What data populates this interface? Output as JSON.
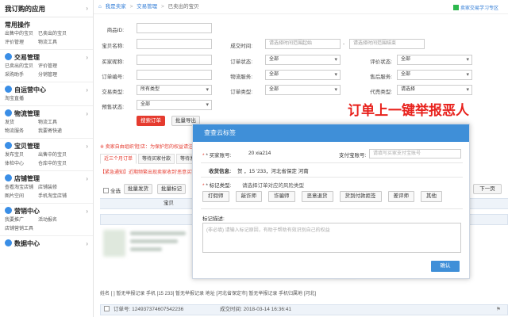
{
  "sidebar": {
    "app_title": "我订购的应用",
    "sections": [
      {
        "title": "常用操作",
        "links": [
          "出售中的宝贝",
          "已卖出的宝贝",
          "评价管理",
          "物流工具"
        ]
      },
      {
        "title": "交易管理",
        "links": [
          "已卖出的宝贝",
          "评价管理",
          "采购助手",
          "分销管理"
        ]
      },
      {
        "title": "自运营中心",
        "links": [
          "淘宝直播"
        ]
      },
      {
        "title": "物流管理",
        "links": [
          "发货",
          "物流工具",
          "物流服务",
          "我要寄快递"
        ]
      },
      {
        "title": "宝贝管理",
        "links": [
          "发布宝贝",
          "出售中的宝贝",
          "体检中心",
          "仓库中的宝贝"
        ]
      },
      {
        "title": "店铺管理",
        "links": [
          "查看淘宝店铺",
          "店铺装修",
          "图片空间",
          "手机淘宝店铺"
        ]
      },
      {
        "title": "营销中心",
        "links": [
          "我要推广",
          "活动报名",
          "店铺营销工具"
        ]
      },
      {
        "title": "数据中心",
        "links": []
      }
    ]
  },
  "breadcrumb": {
    "home": "我是卖家",
    "level1": "交易管理",
    "level2": "已卖出的宝贝"
  },
  "guide_link": "卖家交易学习专区",
  "filters": {
    "product_name_label": "商品ID:",
    "title_label": "宝贝名称:",
    "buyer_label": "买家昵称:",
    "order_no_label": "订单编号:",
    "order_type_label": "交易类型:",
    "order_type_value": "所有类型",
    "eval_label": "预售状态:",
    "eval_value": "全部",
    "time_label": "成交时间:",
    "time_start_placeholder": "请选择时间范围起始",
    "time_end_placeholder": "请选择时间范围结束",
    "order_status_label": "订单状态:",
    "order_status_value": "全部",
    "logistics_label": "物流服务:",
    "logistics_value": "全部",
    "aftersale_label": "售后服务:",
    "aftersale_value": "全部",
    "order_kind_label": "订单类型:",
    "order_kind_value": "全部",
    "rating_label": "评价状态:",
    "rating_value": "全部",
    "pay_label": "付款方式:",
    "pay_value": "全部",
    "agent_label": "代売类型:",
    "agent_value": "请选择",
    "search_button": "搜索订单",
    "export_button": "批量导出"
  },
  "annotation": "订单上一键举报恶人",
  "notices": [
    "※ 卖家自由组织'阻'店：为保护您的权益请注意！",
    "【紧急通知】近期频繁出现卖家收到'恶意买家'的情况，请注意识别！"
  ],
  "tabs": [
    "近三个月订单",
    "等待买家付款",
    "等待发货"
  ],
  "table": {
    "select_all": "全选",
    "batch_ship": "批量发货",
    "batch_flag": "批量标记",
    "prev_page": "上一页",
    "next_page": "下一页",
    "col_product": "宝贝",
    "order_rows": [
      {
        "order_no": "订单号: 124937374607542236",
        "time": "成交时间: 2018-03-14 16:36:41"
      }
    ],
    "bottom_info": "姓名 [ ] 暂无举报记录   手机 [15       233] 暂无举报记录   地址 [河北省保定市] 暂无举报记录   手机归属地 [河北]"
  },
  "modal": {
    "title": "查查云标签",
    "nickname_label": "* 买家账号:",
    "nickname_value": "20 xia214",
    "alipay_label": "支付宝账号:",
    "alipay_placeholder": "请填写买家支付宝账号",
    "receiver_label": "收货信息:",
    "receiver_value": "贺          ，15           '233，河北省保定     河南",
    "tag_label": "* 标记类型:",
    "tag_hint": "请选择订单对应的风险类型",
    "tags": [
      "打假师",
      "敲诈师",
      "诈骗师",
      "恶意退货",
      "货到付款拒签",
      "差评师",
      "其他"
    ],
    "reason_label": "标记描述:",
    "reason_placeholder": "(非必填) 请输入标记原因，有助于帮助有效识别自己的权益",
    "confirm": "确认"
  }
}
